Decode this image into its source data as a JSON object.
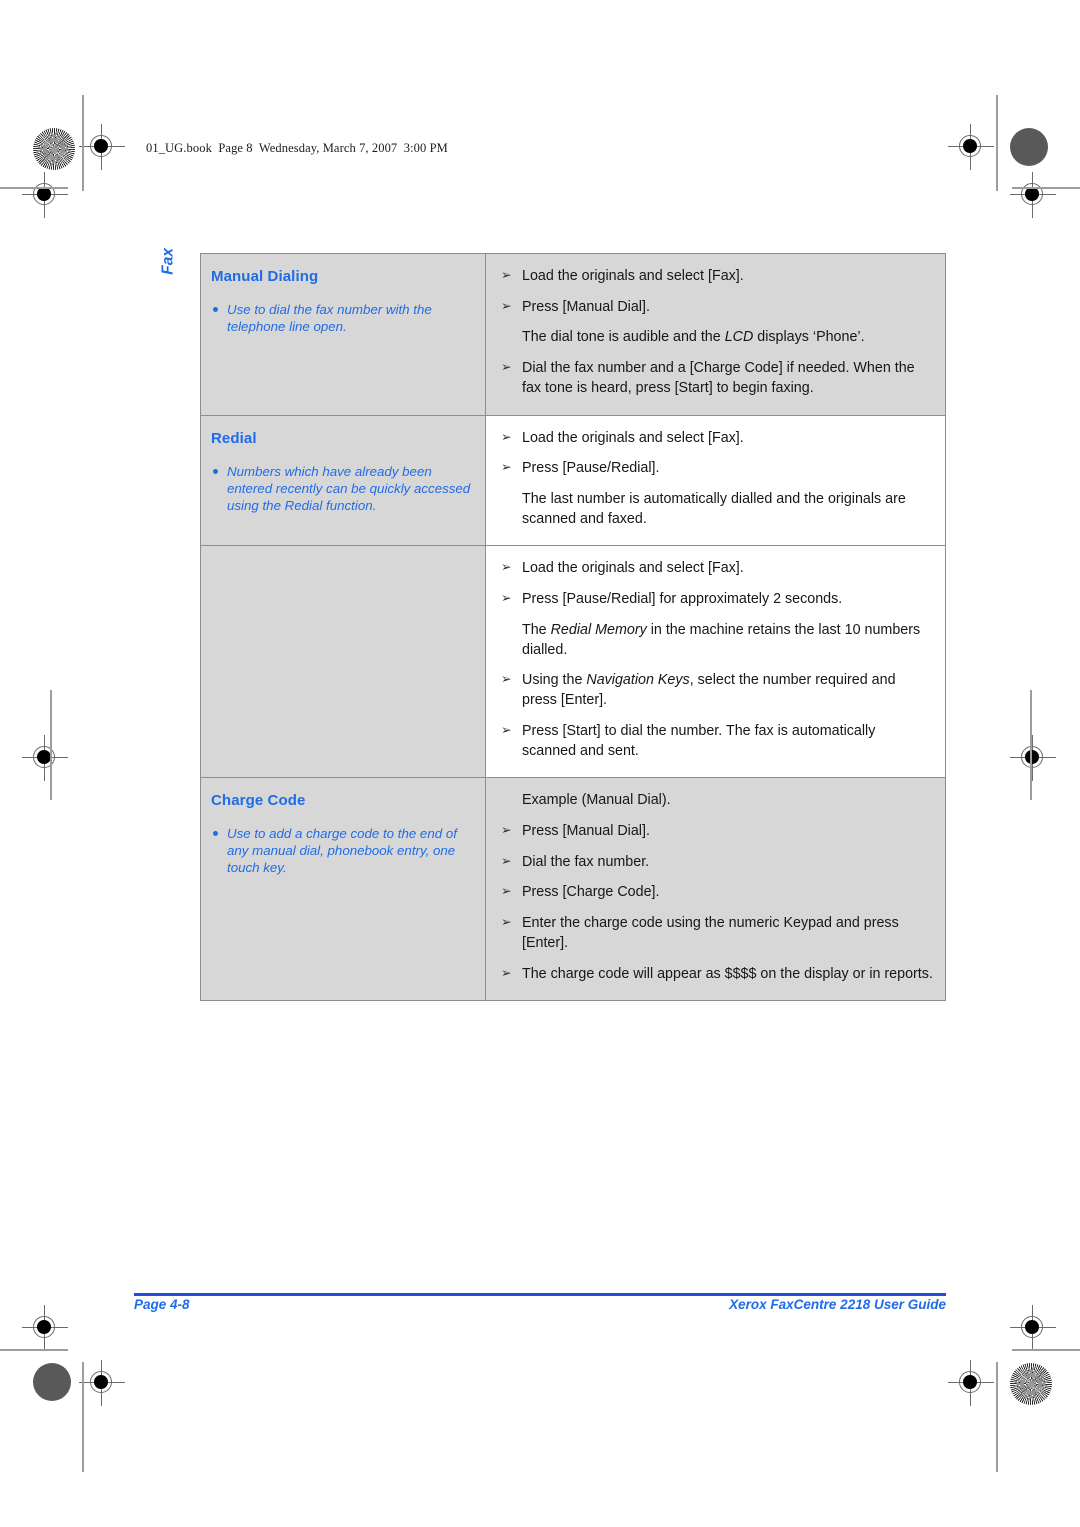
{
  "page": {
    "book_header": "01_UG.book  Page 8  Wednesday, March 7, 2007  3:00 PM",
    "chapter_tab": "Fax",
    "accent_blue": "#1f6ce8",
    "rule_blue": "#1f4fe0",
    "shade_gray": "#d7d7d7"
  },
  "table": {
    "rows": [
      {
        "title": "Manual Dialing",
        "note": "Use to dial the fax number with the telephone line open.",
        "shaded": true,
        "steps": [
          {
            "bullet": true,
            "text": "Load the originals and select [Fax]."
          },
          {
            "bullet": true,
            "text": "Press [Manual Dial]."
          },
          {
            "bullet": false,
            "text": "The dial tone is audible and the LCD displays ‘Phone’.",
            "italic": "LCD"
          },
          {
            "bullet": true,
            "text": "Dial the fax number and a [Charge Code] if needed. When the fax tone is heard, press [Start] to begin faxing."
          }
        ]
      },
      {
        "title": "Redial",
        "note": "Numbers which have already been entered recently can be quickly accessed using the Redial function.",
        "shaded": false,
        "steps": [
          {
            "bullet": true,
            "text": "Load the originals and select [Fax]."
          },
          {
            "bullet": true,
            "text": "Press [Pause/Redial]."
          },
          {
            "bullet": false,
            "text": "The last number is automatically dialled and the originals are scanned and faxed."
          }
        ]
      },
      {
        "title": "",
        "note": "",
        "shaded": false,
        "steps": [
          {
            "bullet": true,
            "text": "Load the originals and select [Fax]."
          },
          {
            "bullet": true,
            "text": "Press [Pause/Redial] for approximately 2 seconds."
          },
          {
            "bullet": false,
            "text": "The Redial Memory in the machine retains the last 10 numbers dialled.",
            "italic": "Redial Memory"
          },
          {
            "bullet": true,
            "text": "Using the Navigation Keys, select the number required and press [Enter].",
            "italic": "Navigation Keys"
          },
          {
            "bullet": true,
            "text": "Press [Start] to dial the number. The fax is automatically scanned and sent."
          }
        ]
      },
      {
        "title": "Charge Code",
        "note": "Use to add a charge code to the end of any manual dial, phonebook entry, one touch key.",
        "shaded": true,
        "steps": [
          {
            "bullet": false,
            "text": "Example (Manual Dial)."
          },
          {
            "bullet": true,
            "text": "Press [Manual Dial]."
          },
          {
            "bullet": true,
            "text": "Dial the fax number."
          },
          {
            "bullet": true,
            "text": "Press [Charge Code]."
          },
          {
            "bullet": true,
            "text": "Enter the charge code using the numeric Keypad and press [Enter]."
          },
          {
            "bullet": true,
            "text": "The charge code will appear as $$$$ on the display or in reports."
          }
        ]
      }
    ]
  },
  "footer": {
    "page_number": "Page 4-8",
    "guide_title": "Xerox FaxCentre 2218 User Guide"
  }
}
